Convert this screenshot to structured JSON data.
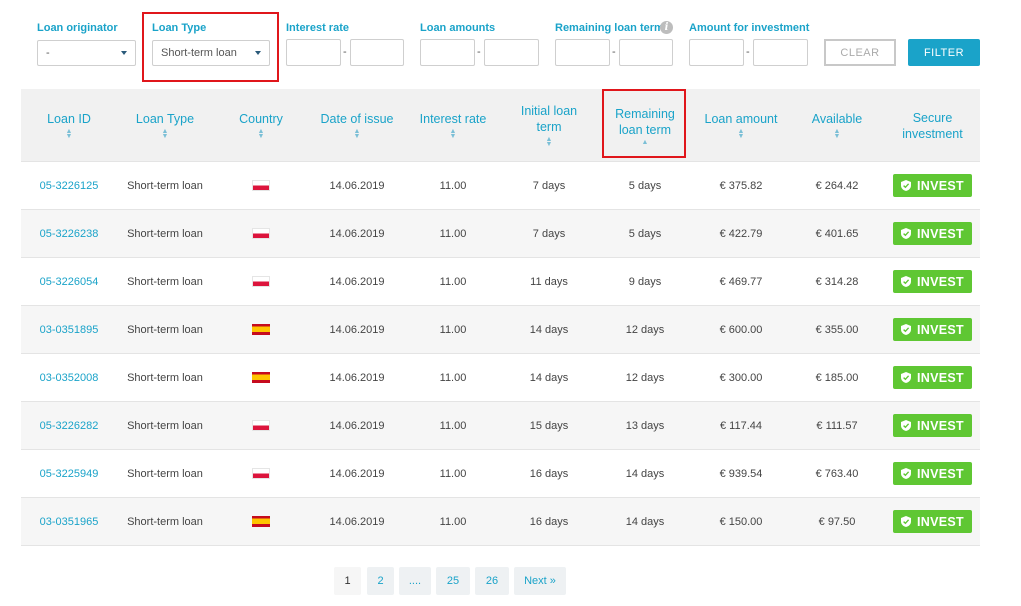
{
  "filters": {
    "loan_originator": {
      "label": "Loan originator",
      "value": "-"
    },
    "loan_type": {
      "label": "Loan Type",
      "value": "Short-term loan"
    },
    "interest_rate": {
      "label": "Interest rate",
      "from": "",
      "to": ""
    },
    "loan_amounts": {
      "label": "Loan amounts",
      "from": "",
      "to": ""
    },
    "remaining_term": {
      "label": "Remaining loan term",
      "from": "",
      "to": ""
    },
    "amount_investment": {
      "label": "Amount for investment",
      "from": "",
      "to": ""
    },
    "dash": "-",
    "info_icon": "i",
    "clear_label": "CLEAR",
    "filter_label": "FILTER"
  },
  "table": {
    "headers": {
      "loan_id": "Loan ID",
      "loan_type": "Loan Type",
      "country": "Country",
      "date_of_issue": "Date of issue",
      "interest_rate": "Interest rate",
      "initial_term_1": "Initial loan",
      "initial_term_2": "term",
      "remaining_term_1": "Remaining",
      "remaining_term_2": "loan term",
      "loan_amount": "Loan amount",
      "available": "Available",
      "secure_1": "Secure",
      "secure_2": "investment"
    },
    "invest_label": "INVEST",
    "rows": [
      {
        "id": "05-3226125",
        "type": "Short-term loan",
        "flag": "pl",
        "date": "14.06.2019",
        "rate": "11.00",
        "initial": "7 days",
        "remaining": "5 days",
        "amount": "€ 375.82",
        "available": "€ 264.42"
      },
      {
        "id": "05-3226238",
        "type": "Short-term loan",
        "flag": "pl",
        "date": "14.06.2019",
        "rate": "11.00",
        "initial": "7 days",
        "remaining": "5 days",
        "amount": "€ 422.79",
        "available": "€ 401.65"
      },
      {
        "id": "05-3226054",
        "type": "Short-term loan",
        "flag": "pl",
        "date": "14.06.2019",
        "rate": "11.00",
        "initial": "11 days",
        "remaining": "9 days",
        "amount": "€ 469.77",
        "available": "€ 314.28"
      },
      {
        "id": "03-0351895",
        "type": "Short-term loan",
        "flag": "es",
        "date": "14.06.2019",
        "rate": "11.00",
        "initial": "14 days",
        "remaining": "12 days",
        "amount": "€ 600.00",
        "available": "€ 355.00"
      },
      {
        "id": "03-0352008",
        "type": "Short-term loan",
        "flag": "es",
        "date": "14.06.2019",
        "rate": "11.00",
        "initial": "14 days",
        "remaining": "12 days",
        "amount": "€ 300.00",
        "available": "€ 185.00"
      },
      {
        "id": "05-3226282",
        "type": "Short-term loan",
        "flag": "pl",
        "date": "14.06.2019",
        "rate": "11.00",
        "initial": "15 days",
        "remaining": "13 days",
        "amount": "€ 117.44",
        "available": "€ 111.57"
      },
      {
        "id": "05-3225949",
        "type": "Short-term loan",
        "flag": "pl",
        "date": "14.06.2019",
        "rate": "11.00",
        "initial": "16 days",
        "remaining": "14 days",
        "amount": "€ 939.54",
        "available": "€ 763.40"
      },
      {
        "id": "03-0351965",
        "type": "Short-term loan",
        "flag": "es",
        "date": "14.06.2019",
        "rate": "11.00",
        "initial": "16 days",
        "remaining": "14 days",
        "amount": "€ 150.00",
        "available": "€ 97.50"
      }
    ]
  },
  "pagination": {
    "pages": [
      "1",
      "2",
      "....",
      "25",
      "26",
      "Next »"
    ],
    "current": "1"
  },
  "colors": {
    "accent": "#1aa3c9",
    "invest_green": "#5fc733",
    "highlight_red": "#e0161b"
  },
  "icons": {
    "dropdown": "chevron-down-icon",
    "info": "info-icon",
    "sort": "sort-icon",
    "invest": "shield-check-icon",
    "flag_pl": "poland-flag-icon",
    "flag_es": "spain-flag-icon"
  }
}
